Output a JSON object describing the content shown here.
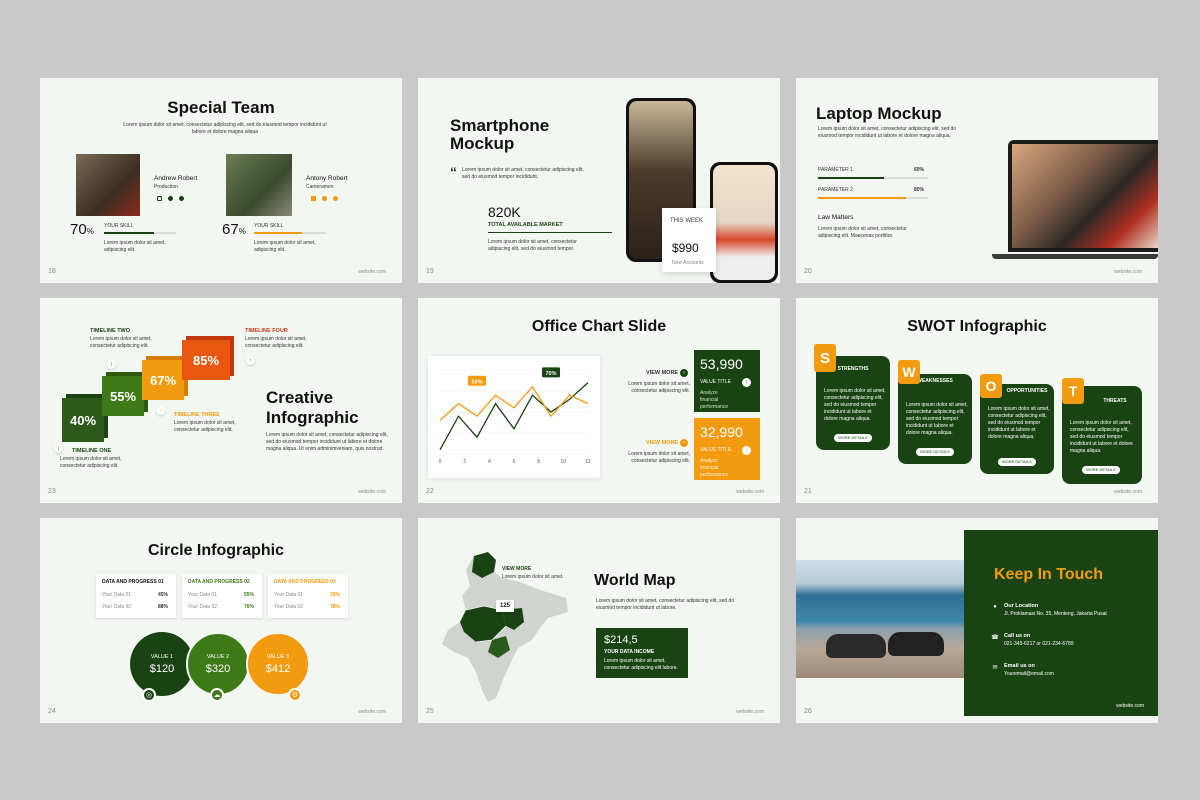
{
  "site": "website.com",
  "lorem_line": "Lorem ipsum dolor sit amet, consectetur adipiscing elit.",
  "colors": {
    "dark_green": "#1a4314",
    "orange": "#f29b0f",
    "red": "#c8371b",
    "mid_green": "#3d7a17"
  },
  "s1": {
    "num": "18",
    "title": "Special Team",
    "subtitle": "Lorem ipsum dolor sit amet, consectetur adipiscing elit, sed do eiusmod tempor incididunt ut labore et dolore magna aliqua",
    "members": [
      {
        "name": "Andrew Robert",
        "role": "Production",
        "pct": "70",
        "unit": "%",
        "skill": "YOUR SKILL",
        "desc": "Lorem ipsum dolor sit amet, adipiscing elit."
      },
      {
        "name": "Antony Robert",
        "role": "Cameramen",
        "pct": "67",
        "unit": "%",
        "skill": "YOUR SKILL",
        "desc": "Lorem ipsum dolor sit amet, adipiscing elit."
      }
    ]
  },
  "s2": {
    "num": "19",
    "title1": "Smartphone",
    "title2": "Mockup",
    "quote": "Lorem ipsum dolor sit amet, consectetur adipiscing elit, sed do eiusmod tempor incididunt.",
    "stat": "820K",
    "stat_label": "TOTAL AVAILABLE MARKET",
    "desc": "Lorem ipsum dolor sit amet, consectetur adipiscing elit, sed do eiusmod tempor.",
    "card_label": "THIS WEEK",
    "card_value": "$990",
    "card_sub": "New Accounts"
  },
  "s3": {
    "num": "20",
    "title": "Laptop Mockup",
    "desc": "Lorem ipsum dolor sit amet, consectetur adipiscing elit, sed do eiusmod tempor incididunt ut labore et dolore magna aliqua.",
    "params": [
      {
        "label": "PARAMETER 1",
        "value": "60%",
        "level": 0.6
      },
      {
        "label": "PARAMETER 2",
        "value": "80%",
        "level": 0.8
      }
    ],
    "law": "Law Matters",
    "law_desc": "Lorem ipsum dolor sit amet, consectetur adipiscing elit. Maecenas porttitor."
  },
  "s4": {
    "num": "23",
    "title1": "Creative",
    "title2": "Infographic",
    "steps": [
      "40%",
      "55%",
      "67%",
      "85%"
    ],
    "t_two": "TIMELINE TWO",
    "t_four": "TIMELINE FOUR",
    "t_three": "TIMELINE THREE",
    "t_one": "TIMELINE ONE",
    "short": "Lorem ipsum dolor sit amet, consectetur adipiscing elit.",
    "long": "Lorem ipsum dolor sit amet, consectetur adipiscing elit, sed do eiusmod tempor incididunt ut labore et dolore magna aliqua. Ut enim adminimveniam, quis nostrud."
  },
  "s5": {
    "num": "22",
    "title": "Office Chart Slide",
    "view1": "VIEW MORE",
    "view2": "VIEW MORE",
    "sub1": "Lorem ipsum dolor sit amet, consectetur adipiscing elit.",
    "sub2": "Lorem ipsum dolor sit amet, consectetur adipiscing elit.",
    "card1_value": "53,990",
    "card1_label": "VALUE TITLE",
    "card1_desc": "Analyze financial performance",
    "card2_value": "32,990",
    "card2_label": "VALUE TITLE",
    "card2_desc": "Analyze financial performance",
    "chart_data": {
      "type": "line",
      "x": [
        0,
        1.5,
        3,
        4.5,
        6,
        7.5,
        9,
        10.5,
        12
      ],
      "ticks": [
        "0",
        "2",
        "4",
        "6",
        "8",
        "10",
        "12"
      ],
      "xlim": [
        0,
        12
      ],
      "ylim": [
        0,
        100
      ],
      "series": [
        {
          "values": [
            5,
            45,
            20,
            60,
            30,
            70,
            50,
            65,
            85
          ]
        },
        {
          "values": [
            40,
            60,
            45,
            70,
            55,
            80,
            45,
            70,
            60
          ]
        }
      ],
      "labels": [
        {
          "text": "50%"
        },
        {
          "text": "70%"
        }
      ]
    }
  },
  "s6": {
    "num": "21",
    "title": "SWOT Infographic",
    "items": [
      {
        "letter": "S",
        "name": "STRENGTHS",
        "desc": "Lorem ipsum dolor sit amet, consectetur adipiscing elit, sed do eiusmod tempor incididunt ut labore et dolore magna aliqua.",
        "btn": "MORE DETAILS"
      },
      {
        "letter": "W",
        "name": "WEAKNESSES",
        "desc": "Lorem ipsum dolor sit amet, consectetur adipiscing elit, sed do eiusmod tempor incididunt ut labore et dolore magna aliqua.",
        "btn": "MORE DETAILS"
      },
      {
        "letter": "O",
        "name": "OPPORTUNITIES",
        "desc": "Lorem ipsum dolor sit amet, consectetur adipiscing elit, sed do eiusmod tempor incididunt ut labore et dolore magna aliqua.",
        "btn": "MORE DETAILS"
      },
      {
        "letter": "T",
        "name": "THREATS",
        "desc": "Lorem ipsum dolor sit amet, consectetur adipiscing elit, sed do eiusmod tempor incididunt ut labore et dolore magna aliqua.",
        "btn": "MORE DETAILS"
      }
    ]
  },
  "s7": {
    "num": "24",
    "title": "Circle Infographic",
    "cards": [
      {
        "title": "DATA AND PROGRESS 01",
        "r1": "Your Data 01",
        "v1": "45%",
        "r2": "Your Data 02",
        "v2": "88%"
      },
      {
        "title": "DATA AND PROGRESS 02",
        "r1": "Your Data 01",
        "v1": "55%",
        "r2": "Your Data 02",
        "v2": "76%"
      },
      {
        "title": "DATA AND PROGRESS 03",
        "r1": "Your Data 01",
        "v1": "35%",
        "r2": "Your Data 02",
        "v2": "78%"
      }
    ],
    "circles": [
      {
        "label": "VALUE 1",
        "value": "$120"
      },
      {
        "label": "VALUE 2",
        "value": "$320"
      },
      {
        "label": "VALUE 3",
        "value": "$412"
      }
    ]
  },
  "s8": {
    "num": "25",
    "title": "World Map",
    "view": "VIEW MORE",
    "view_desc": "Lorem ipsum dolor sit amet.",
    "badge": "125",
    "desc": "Lorem ipsum dolor sit amet, consectetur adipiscing elit, sed do eiusmod tempor incididunt ut labore.",
    "card_value": "$214,5",
    "card_label": "YOUR DATA INCOME",
    "card_desc": "Lorem ipsum dolor sit amet, consectetur adipiscing elit labore."
  },
  "s9": {
    "num": "26",
    "title": "Keep In Touch",
    "loc_label": "Our Location",
    "loc": "Jl. Proklamasi No. 35, Menteng, Jakarta Pusat",
    "call_label": "Call us on",
    "call": "021-345-6217 or 021-234-6789",
    "email_label": "Email us on",
    "email": "Youremail@email.com"
  }
}
